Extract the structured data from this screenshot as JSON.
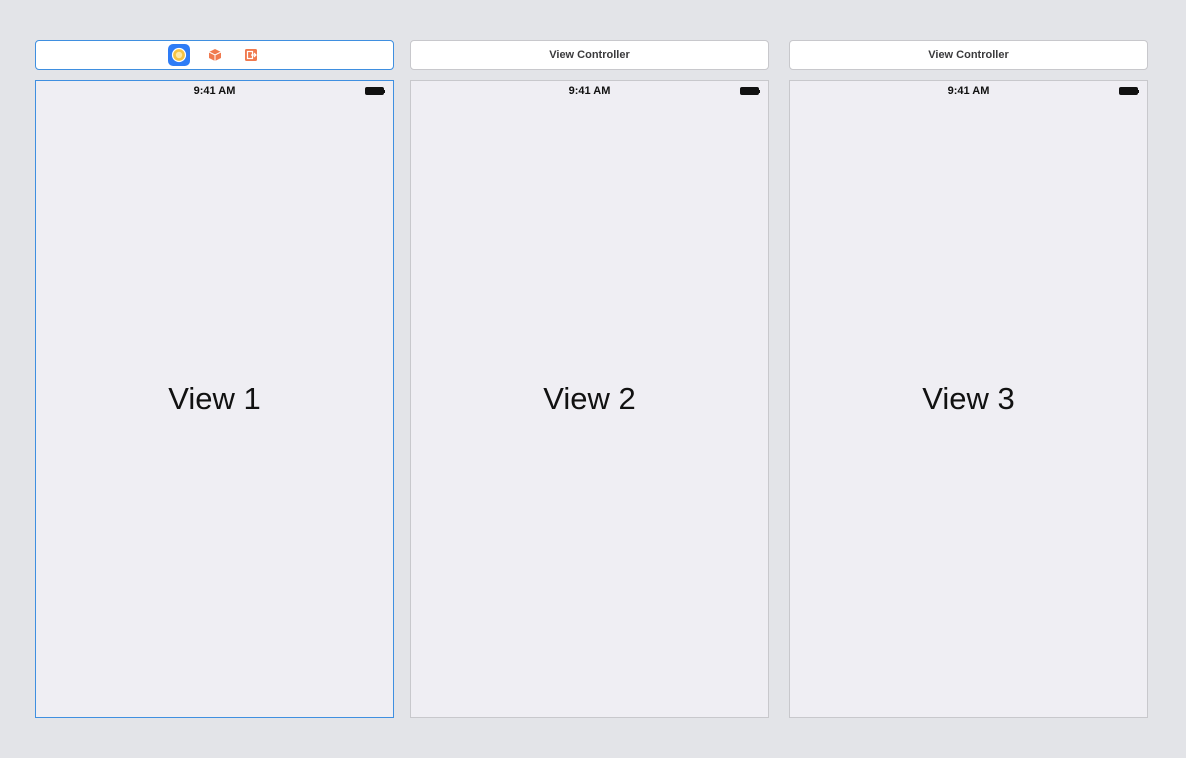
{
  "scenes": [
    {
      "title": "",
      "selected": true,
      "bar_icons": [
        "view-controller-icon",
        "first-responder-icon",
        "exit-icon"
      ],
      "status_time": "9:41 AM",
      "view_label": "View 1"
    },
    {
      "title": "View Controller",
      "selected": false,
      "status_time": "9:41 AM",
      "view_label": "View 2"
    },
    {
      "title": "View Controller",
      "selected": false,
      "status_time": "9:41 AM",
      "view_label": "View 3"
    }
  ],
  "colors": {
    "canvas_background": "#e3e4e8",
    "selection_border": "#3f8fe0",
    "view_controller_icon": "#2e7cf6",
    "first_responder_icon": "#f07a4f",
    "exit_icon": "#f07a4f",
    "device_background": "#efeef3"
  }
}
